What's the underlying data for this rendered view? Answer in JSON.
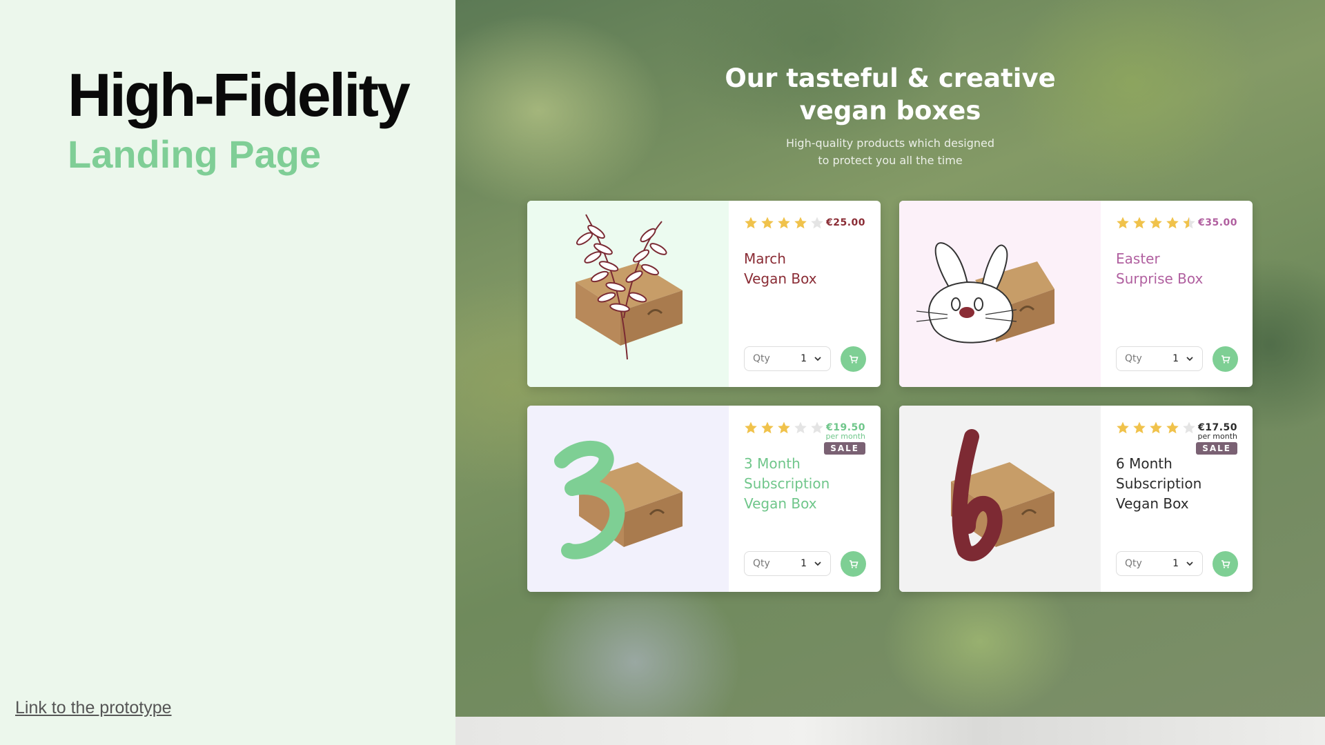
{
  "slide": {
    "title": "High-Fidelity",
    "subtitle": "Landing Page",
    "link_text": "Link to the prototype"
  },
  "hero": {
    "heading_line1": "Our tasteful & creative",
    "heading_line2": "vegan boxes",
    "sub_line1": "High-quality products which designed",
    "sub_line2": "to protect you all the time"
  },
  "colors": {
    "accent_green": "#7ecf94",
    "star_gold": "#f0c24b",
    "sale_badge": "#7a6173"
  },
  "products": [
    {
      "name_line1": "March",
      "name_line2": "Vegan Box",
      "name_line3": "",
      "price": "€25.00",
      "per_month": "",
      "badge": "",
      "rating": 4,
      "name_color": "#8a2c35",
      "price_color": "#8a2c35",
      "image_bg": "#ecfbf0",
      "icon": "herb-box-icon",
      "qty_label": "Qty",
      "qty_value": "1"
    },
    {
      "name_line1": "Easter",
      "name_line2": "Surprise Box",
      "name_line3": "",
      "price": "€35.00",
      "per_month": "",
      "badge": "",
      "rating": 4.5,
      "name_color": "#b05f9f",
      "price_color": "#b05f9f",
      "image_bg": "#fcf1f9",
      "icon": "bunny-box-icon",
      "qty_label": "Qty",
      "qty_value": "1"
    },
    {
      "name_line1": "3 Month",
      "name_line2": "Subscription",
      "name_line3": "Vegan Box",
      "price": "€19.50",
      "per_month": "per month",
      "badge": "SALE",
      "rating": 3,
      "name_color": "#6fc68a",
      "price_color": "#6fc68a",
      "image_bg": "#f2f1fc",
      "icon": "number-three-box-icon",
      "qty_label": "Qty",
      "qty_value": "1"
    },
    {
      "name_line1": "6 Month",
      "name_line2": "Subscription",
      "name_line3": "Vegan Box",
      "price": "€17.50",
      "per_month": "per month",
      "badge": "SALE",
      "rating": 4,
      "name_color": "#2b2b2b",
      "price_color": "#2b2b2b",
      "image_bg": "#f2f2f2",
      "icon": "number-six-box-icon",
      "qty_label": "Qty",
      "qty_value": "1"
    }
  ]
}
